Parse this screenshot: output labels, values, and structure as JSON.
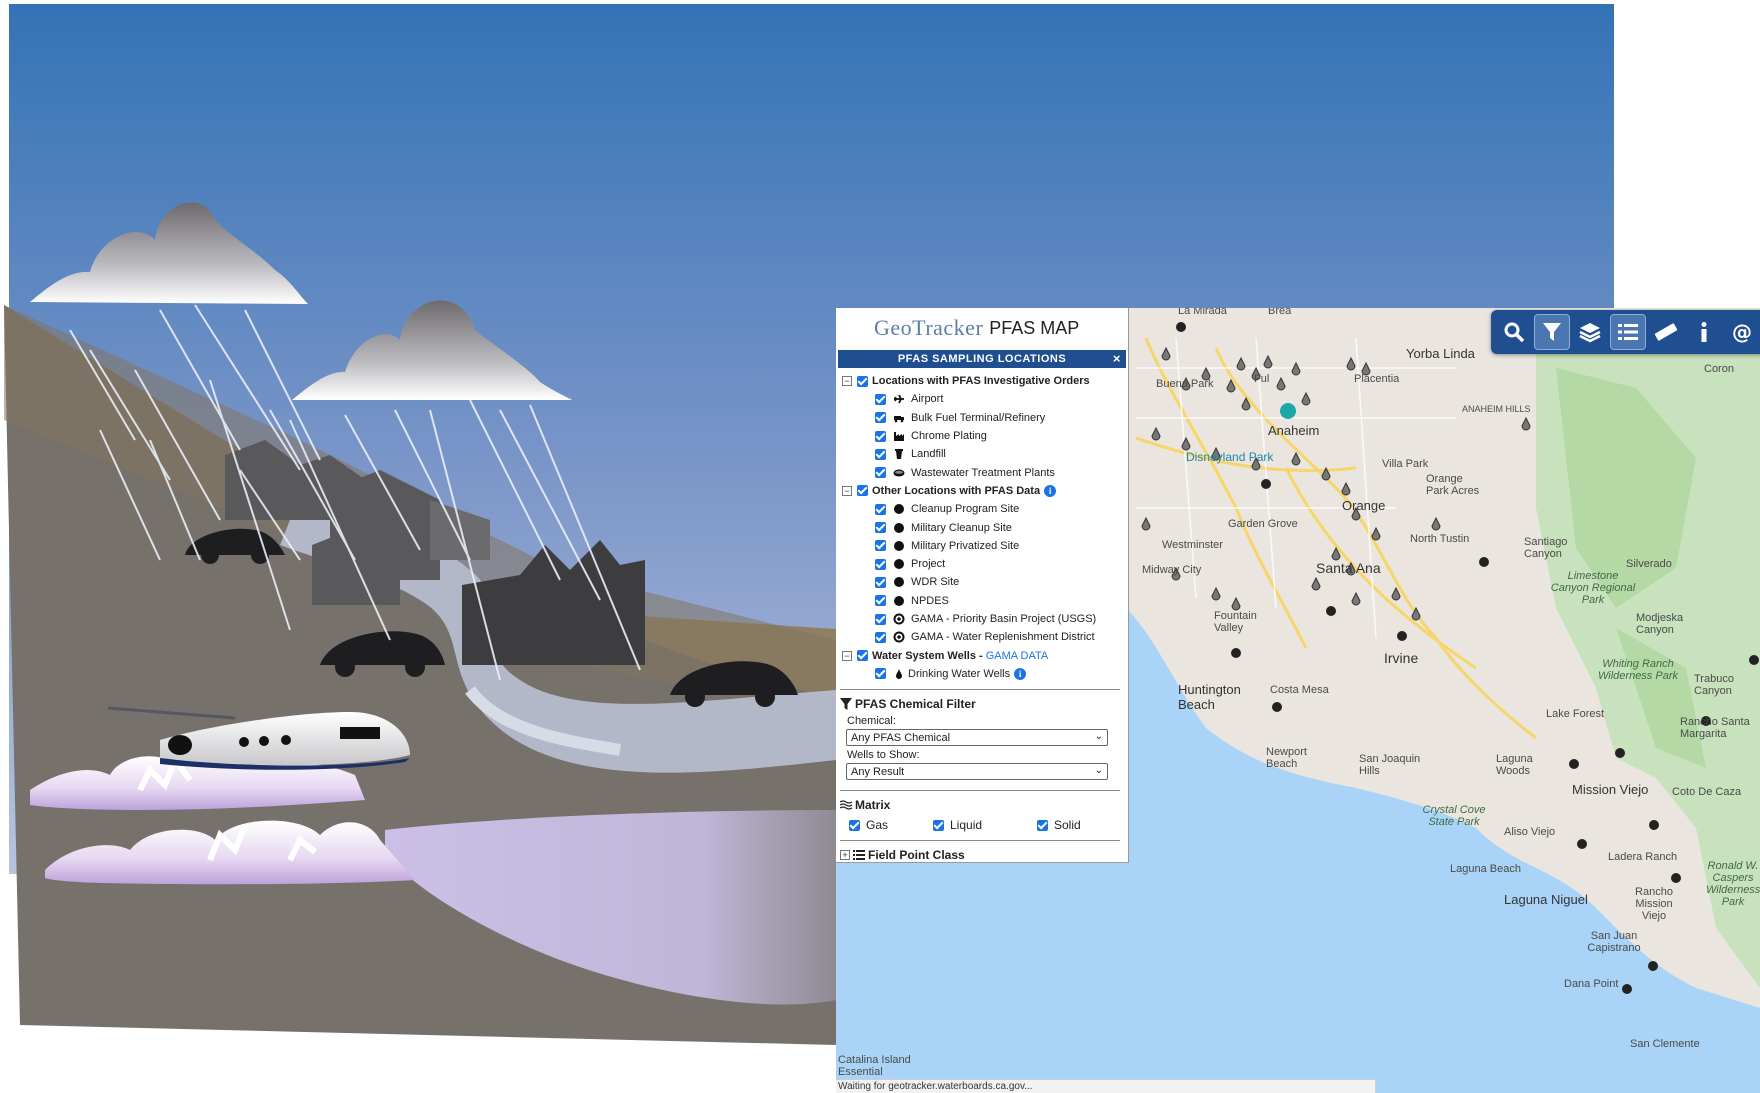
{
  "app": {
    "logo_geo": "GeoTracker",
    "logo_pfas": "PFAS MAP"
  },
  "toolbar": {
    "buttons": [
      "search-icon",
      "filter-icon",
      "layers-icon",
      "list-icon",
      "ruler-icon",
      "info-icon",
      "at-icon"
    ],
    "active": [
      "filter-icon",
      "list-icon"
    ]
  },
  "panel": {
    "title": "PFAS SAMPLING LOCATIONS",
    "close": "×",
    "groups": [
      {
        "label": "Locations with PFAS Investigative Orders",
        "items": [
          "Airport",
          "Bulk Fuel Terminal/Refinery",
          "Chrome Plating",
          "Landfill",
          "Wastewater Treatment Plants"
        ]
      },
      {
        "label": "Other Locations with PFAS Data",
        "items": [
          "Cleanup Program Site",
          "Military Cleanup Site",
          "Military Privatized Site",
          "Project",
          "WDR Site",
          "NPDES",
          "GAMA - Priority Basin Project (USGS)",
          "GAMA - Water Replenishment District"
        ]
      },
      {
        "label": "Water System Wells",
        "link": "GAMA DATA",
        "separator": " - ",
        "items": [
          "Drinking Water Wells"
        ]
      }
    ]
  },
  "filter": {
    "title": "PFAS Chemical Filter",
    "chemical_label": "Chemical:",
    "chemical_value": "Any PFAS Chemical",
    "wells_label": "Wells to Show:",
    "wells_value": "Any Result"
  },
  "matrix": {
    "title": "Matrix",
    "options": [
      "Gas",
      "Liquid",
      "Solid"
    ]
  },
  "field_point": {
    "title": "Field Point Class"
  },
  "status": "Waiting for geotracker.waterboards.ca.gov...",
  "map_labels": {
    "la_mirada": "La Mirada",
    "brea": "Brea",
    "yorba_linda": "Yorba Linda",
    "buena_park": "Buena Park",
    "fullerton": "Ful",
    "placentia": "Placentia",
    "anaheim": "Anaheim",
    "anaheim_hills": "ANAHEIM HILLS",
    "disneyland": "Disneyland Park",
    "villa_park": "Villa Park",
    "orange": "Orange",
    "orange_park_acres": "Orange Park Acres",
    "garden_grove": "Garden Grove",
    "westminster": "Westminster",
    "midway_city": "Midway City",
    "santa_ana": "Santa Ana",
    "north_tustin": "North Tustin",
    "santiago_canyon": "Santiago Canyon",
    "silverado": "Silverado",
    "limestone": "Limestone Canyon Regional Park",
    "modjeska": "Modjeska Canyon",
    "fountain_valley": "Fountain Valley",
    "huntington_beach": "Huntington Beach",
    "costa_mesa": "Costa Mesa",
    "irvine": "Irvine",
    "whiting_ranch": "Whiting Ranch Wilderness Park",
    "trabuco": "Trabuco Canyon",
    "lake_forest": "Lake Forest",
    "rancho_santa_margarita": "Rancho Santa Margarita",
    "newport_beach": "Newport Beach",
    "san_joaquin_hills": "San Joaquin Hills",
    "laguna_woods": "Laguna Woods",
    "mission_viejo": "Mission Viejo",
    "coto_de_caza": "Coto De Caza",
    "crystal_cove": "Crystal Cove State Park",
    "aliso_viejo": "Aliso Viejo",
    "ladera_ranch": "Ladera Ranch",
    "laguna_beach": "Laguna Beach",
    "laguna_niguel": "Laguna Niguel",
    "rancho_mission_viejo": "Rancho Mission Viejo",
    "ronald_caspers": "Ronald W. Caspers Wilderness Park",
    "san_juan_capistrano": "San Juan Capistrano",
    "dana_point": "Dana Point",
    "san_clemente": "San Clemente",
    "catalina": "Catalina Island Essential",
    "corona": "Coron"
  },
  "colors": {
    "sky_top": "#3373b6",
    "sky_bottom": "#a9b9d9",
    "hill": "#79736c",
    "water_lavender": "#c9c0e4",
    "ocean": "#a9d4f7",
    "land": "#eae6df",
    "green": "#c5e2b9",
    "header_blue": "#1f4f90",
    "checkbox_blue": "#1a73e8"
  }
}
